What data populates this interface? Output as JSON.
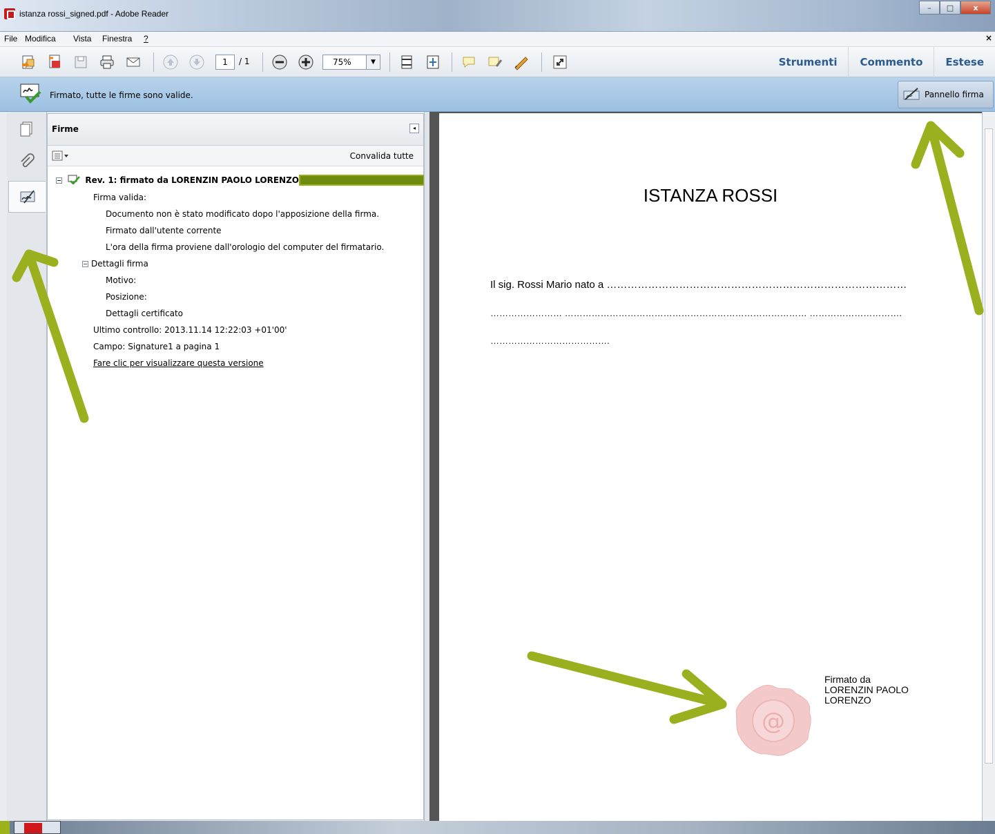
{
  "window": {
    "title": "istanza rossi_signed.pdf - Adobe Reader",
    "minimize": "–",
    "maximize": "□",
    "close": "x"
  },
  "menu": {
    "file": "File",
    "edit": "Modifica",
    "view": "Vista",
    "window": "Finestra",
    "help": "?"
  },
  "toolbar": {
    "page_current": "1",
    "page_total": "/ 1",
    "zoom": "75%",
    "links": [
      "Strumenti",
      "Commento",
      "Estese"
    ]
  },
  "signature_bar": {
    "message": "Firmato, tutte le firme sono valide.",
    "panel_button": "Pannello firma"
  },
  "signatures_panel": {
    "title": "Firme",
    "validate_all": "Convalida tutte",
    "tree": [
      "Rev. 1: firmato da LORENZIN PAOLO LORENZO <",
      "Firma valida:",
      "Documento non è stato modificato dopo l'apposizione della firma.",
      "Firmato dall'utente corrente",
      "L'ora della firma proviene dall'orologio del computer del firmatario.",
      "Dettagli firma",
      "Motivo:",
      "Posizione:",
      "Dettagli certificato",
      "Ultimo controllo: 2013.11.14 12:22:03 +01'00'",
      "Campo: Signature1 a pagina 1",
      "Fare clic per visualizzare questa versione"
    ]
  },
  "document": {
    "title": "ISTANZA ROSSI",
    "line1": "Il sig. Rossi Mario nato a ……………………………………………………………………………",
    "line2": "……………………  ………………………………………………………………………  ………………………….",
    "line3": "………………………………….",
    "signed_by": [
      "Firmato da",
      "LORENZIN PAOLO",
      "LORENZO"
    ]
  },
  "colors": {
    "annotation_arrow": "#9ab01e",
    "link_blue": "#2b5b8f",
    "signature_bar": "#a9c9e8"
  }
}
